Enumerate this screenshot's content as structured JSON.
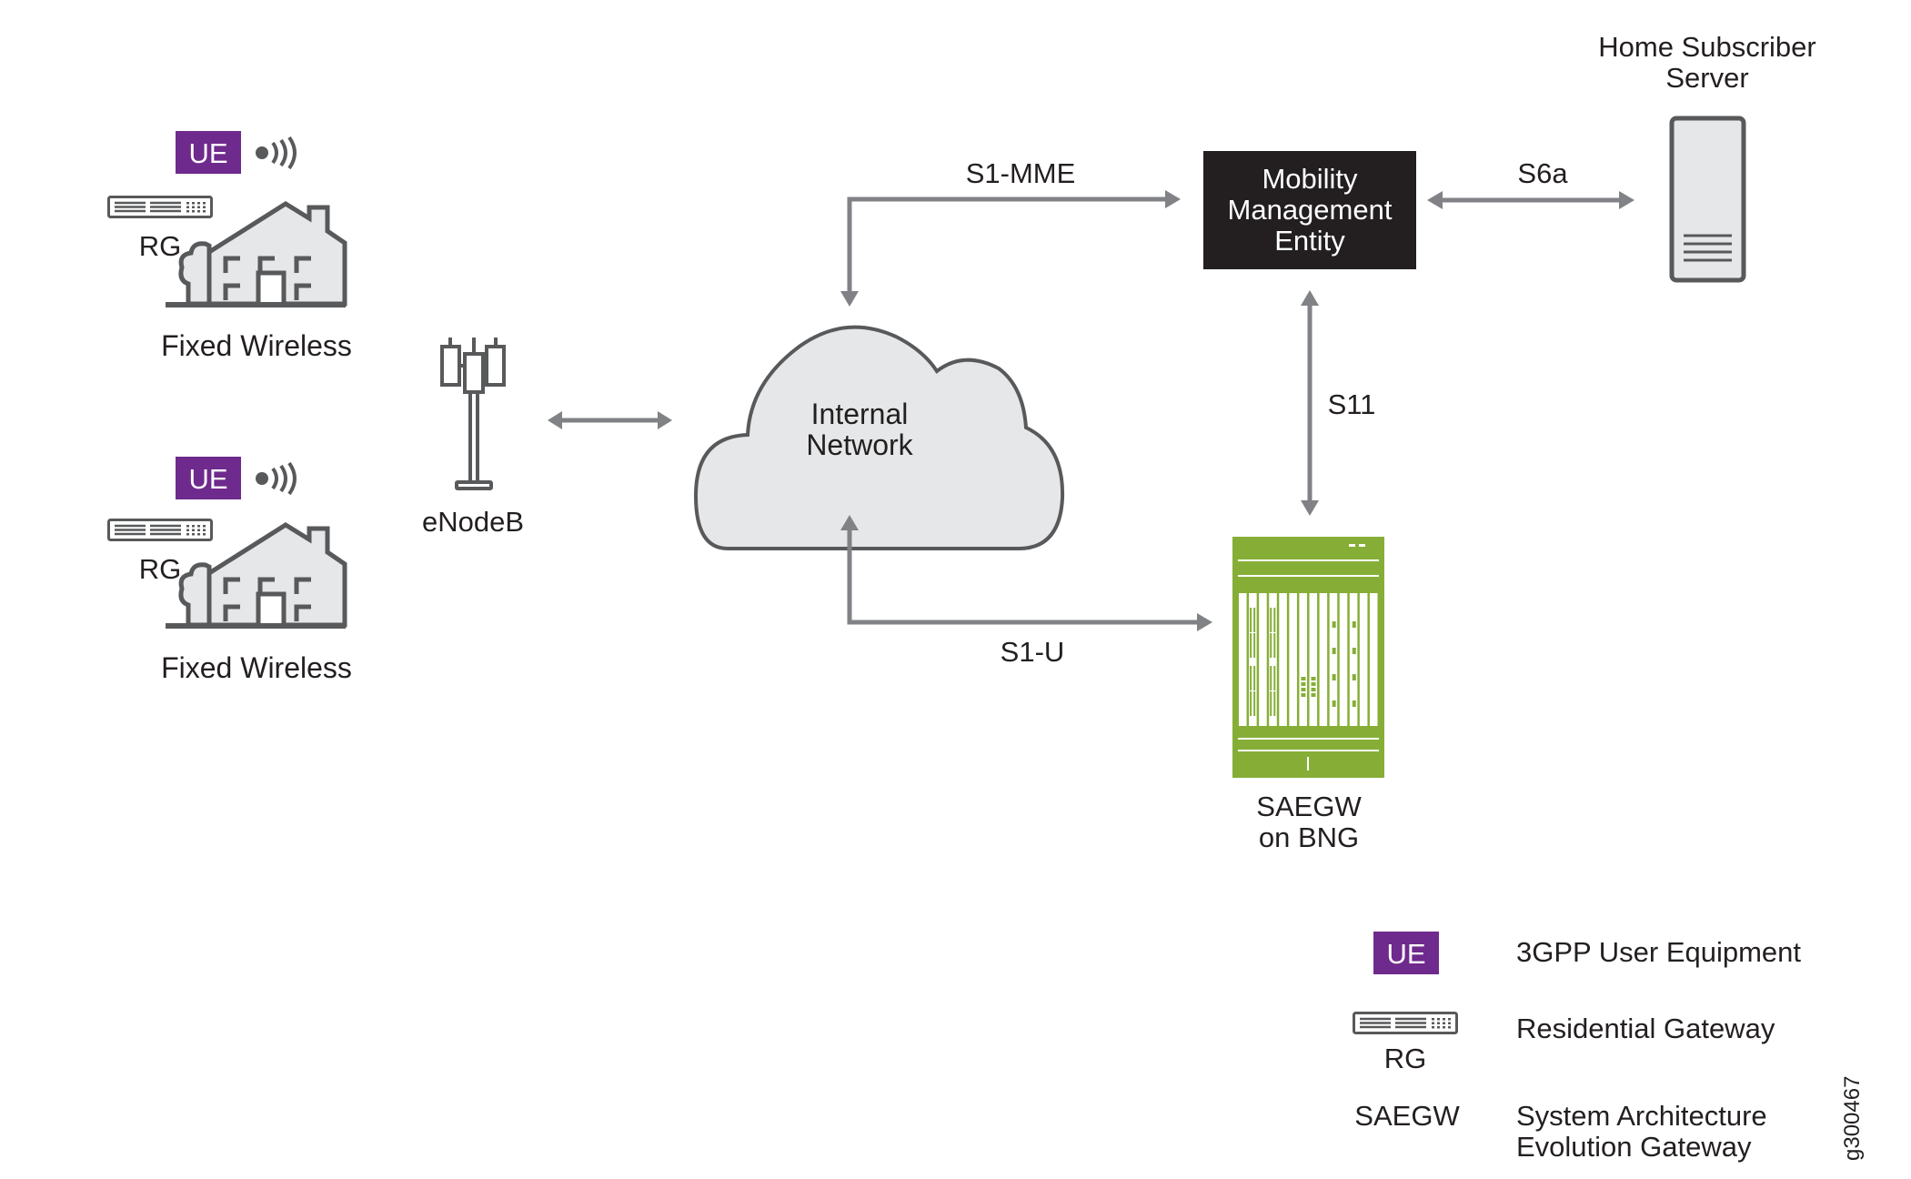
{
  "figure_id": "g300467",
  "colors": {
    "ue_purple": "#6e2a8c",
    "saegw_green": "#86ae37",
    "mme_black": "#231f20",
    "arrow_gray": "#808285",
    "icon_gray": "#58595b",
    "fill_light_gray": "#e6e7e8"
  },
  "sites": [
    {
      "ue_label": "UE",
      "rg_label": "RG",
      "site_label": "Fixed Wireless",
      "icons": [
        "ue-badge",
        "wireless-signal-icon",
        "residential-gateway-icon",
        "house-icon"
      ]
    },
    {
      "ue_label": "UE",
      "rg_label": "RG",
      "site_label": "Fixed Wireless",
      "icons": [
        "ue-badge",
        "wireless-signal-icon",
        "residential-gateway-icon",
        "house-icon"
      ]
    }
  ],
  "nodes": {
    "enodeb": {
      "label": "eNodeB",
      "icon": "cell-tower-icon"
    },
    "internal_network": {
      "line1": "Internal",
      "line2": "Network",
      "icon": "cloud-icon"
    },
    "mme": {
      "line1": "Mobility",
      "line2": "Management",
      "line3": "Entity"
    },
    "hss": {
      "line1": "Home Subscriber",
      "line2": "Server",
      "icon": "server-icon"
    },
    "saegw": {
      "line1": "SAEGW",
      "line2": "on BNG",
      "icon": "router-chassis-icon"
    }
  },
  "links": [
    {
      "id": "enodeb-network",
      "label": "",
      "from": "eNodeB",
      "to": "Internal Network",
      "bidirectional": true
    },
    {
      "id": "s1-mme",
      "label": "S1-MME",
      "from": "Internal Network",
      "to": "Mobility Management Entity",
      "bidirectional": true
    },
    {
      "id": "s6a",
      "label": "S6a",
      "from": "Mobility Management Entity",
      "to": "Home Subscriber Server",
      "bidirectional": true
    },
    {
      "id": "s11",
      "label": "S11",
      "from": "Mobility Management Entity",
      "to": "SAEGW on BNG",
      "bidirectional": true
    },
    {
      "id": "s1-u",
      "label": "S1-U",
      "from": "Internal Network",
      "to": "SAEGW on BNG",
      "bidirectional": true
    }
  ],
  "legend": [
    {
      "symbol": "UE",
      "description_line1": "3GPP User Equipment",
      "description_line2": ""
    },
    {
      "symbol": "RG",
      "description_line1": "Residential Gateway",
      "description_line2": ""
    },
    {
      "symbol": "SAEGW",
      "description_line1": "System Architecture",
      "description_line2": "Evolution Gateway"
    }
  ]
}
